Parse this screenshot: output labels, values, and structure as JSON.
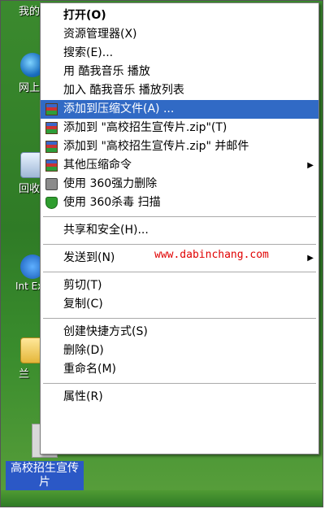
{
  "desktop": {
    "icons": [
      {
        "label": "我的",
        "icon": "my-documents-icon"
      },
      {
        "label": "网上",
        "icon": "network-places-icon"
      },
      {
        "label": "回收",
        "icon": "recycle-bin-icon"
      },
      {
        "label": "Int Expl",
        "icon": "internet-explorer-icon"
      },
      {
        "label": "兰",
        "icon": "folder-icon"
      }
    ],
    "selected_file": {
      "label": "高校招生宣传片",
      "icon": "video-file-icon"
    }
  },
  "context_menu": {
    "items": [
      {
        "label": "打开(O)",
        "bold": true
      },
      {
        "label": "资源管理器(X)"
      },
      {
        "label": "搜索(E)..."
      },
      {
        "label": "用 酷我音乐 播放"
      },
      {
        "label": "加入 酷我音乐 播放列表"
      },
      {
        "label": "添加到压缩文件(A) ...",
        "icon": "winrar-icon",
        "highlighted": true
      },
      {
        "label": "添加到 \"高校招生宣传片.zip\"(T)",
        "icon": "winrar-icon"
      },
      {
        "label": "添加到 \"高校招生宣传片.zip\" 并邮件",
        "icon": "winrar-icon"
      },
      {
        "label": "其他压缩命令",
        "icon": "winrar-icon",
        "submenu": true
      },
      {
        "label": "使用 360强力删除",
        "icon": "shredder-icon"
      },
      {
        "label": "使用 360杀毒 扫描",
        "icon": "shield-icon"
      },
      {
        "label": "共享和安全(H)..."
      },
      {
        "label": "发送到(N)",
        "submenu": true
      },
      {
        "label": "剪切(T)"
      },
      {
        "label": "复制(C)"
      },
      {
        "label": "创建快捷方式(S)"
      },
      {
        "label": "删除(D)"
      },
      {
        "label": "重命名(M)"
      },
      {
        "label": "属性(R)"
      }
    ],
    "watermark": "www.dabinchang.com",
    "highlight_color": "#316ac5"
  }
}
